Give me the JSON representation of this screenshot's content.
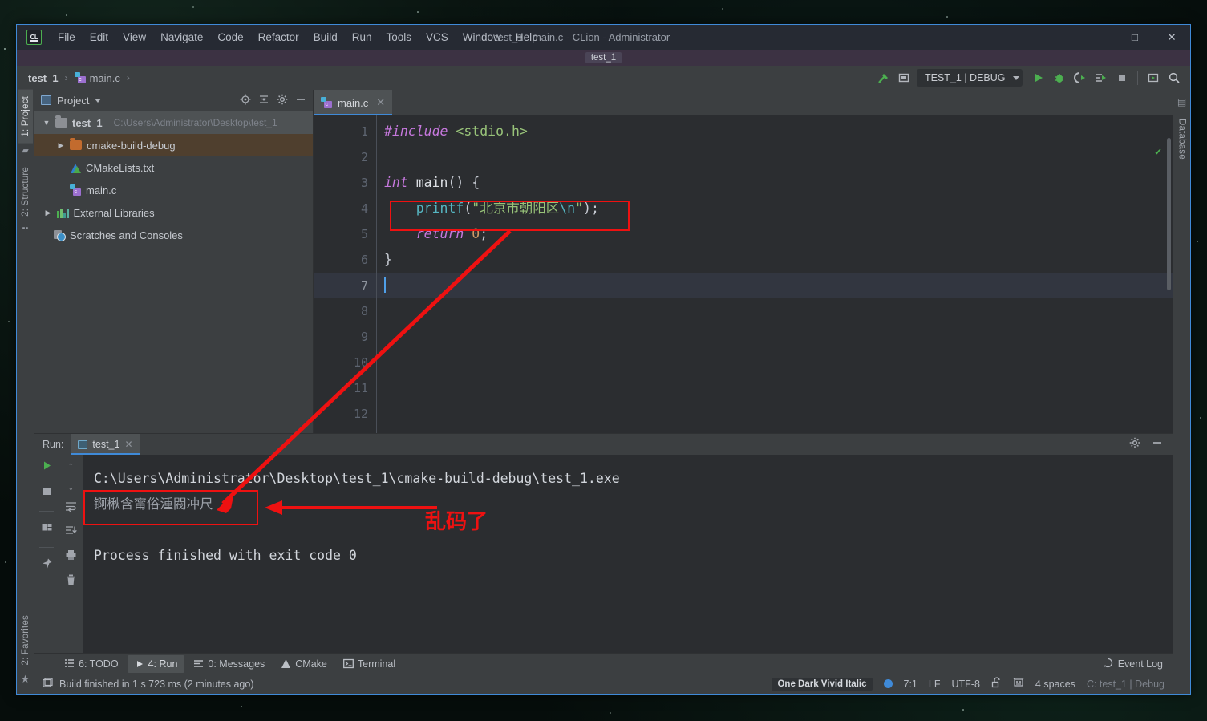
{
  "window": {
    "title": "test_1 - main.c - CLion - Administrator",
    "project_chip": "test_1",
    "logo_text": "CL",
    "minimize": "—",
    "maximize": "□",
    "close": "✕"
  },
  "menu": [
    {
      "label": "File",
      "mnemonic": "F"
    },
    {
      "label": "Edit",
      "mnemonic": "E"
    },
    {
      "label": "View",
      "mnemonic": "V"
    },
    {
      "label": "Navigate",
      "mnemonic": "N"
    },
    {
      "label": "Code",
      "mnemonic": "C"
    },
    {
      "label": "Refactor",
      "mnemonic": "R"
    },
    {
      "label": "Build",
      "mnemonic": "B"
    },
    {
      "label": "Run",
      "mnemonic": "R"
    },
    {
      "label": "Tools",
      "mnemonic": "T"
    },
    {
      "label": "VCS",
      "mnemonic": "V"
    },
    {
      "label": "Window",
      "mnemonic": "W"
    },
    {
      "label": "Help",
      "mnemonic": "H"
    }
  ],
  "navbar": {
    "crumb_project": "test_1",
    "crumb_file": "main.c",
    "separator": "›",
    "run_config": "TEST_1 | DEBUG",
    "icons": [
      "build-hammer-icon",
      "select-target-icon",
      "run-icon",
      "debug-icon",
      "run-with-coverage-icon",
      "profile-icon",
      "stop-icon",
      "update-icon",
      "search-everywhere-icon"
    ]
  },
  "rail_left": {
    "project_tab": "1: Project",
    "structure_tab": "2: Structure",
    "favorites_tab": "2: Favorites"
  },
  "rail_right": {
    "database_tab": "Database"
  },
  "project_panel": {
    "title": "Project",
    "actions": [
      "locate-icon",
      "collapse-all-icon",
      "settings-gear-icon",
      "hide-icon"
    ],
    "tree": [
      {
        "label": "test_1",
        "path": "C:\\Users\\Administrator\\Desktop\\test_1",
        "arrow": "▼",
        "icon": "folder-icon",
        "indent": 0,
        "state": "selected-root"
      },
      {
        "label": "cmake-build-debug",
        "path": "",
        "arrow": "▶",
        "icon": "folder-orange-icon",
        "indent": 1,
        "state": "selected-folder"
      },
      {
        "label": "CMakeLists.txt",
        "path": "",
        "arrow": "",
        "icon": "cmake-file-icon",
        "indent": 1,
        "state": ""
      },
      {
        "label": "main.c",
        "path": "",
        "arrow": "",
        "icon": "c-file-icon",
        "indent": 1,
        "state": ""
      },
      {
        "label": "External Libraries",
        "path": "",
        "arrow": "▶",
        "icon": "library-icon",
        "indent": 0,
        "state": ""
      },
      {
        "label": "Scratches and Consoles",
        "path": "",
        "arrow": "",
        "icon": "scratches-icon",
        "indent": 0,
        "state": ""
      }
    ]
  },
  "editor": {
    "tab_label": "main.c",
    "tab_close": "✕",
    "line_numbers": [
      "1",
      "2",
      "3",
      "4",
      "5",
      "6",
      "7",
      "8",
      "9",
      "10",
      "11",
      "12"
    ],
    "current_line": 7,
    "gutter_run_line": 3,
    "code_lines": [
      {
        "n": 1,
        "tokens": [
          {
            "t": "#include",
            "c": "inc"
          },
          {
            "t": " ",
            "c": "pn"
          },
          {
            "t": "<stdio.h>",
            "c": "hdr"
          }
        ]
      },
      {
        "n": 2,
        "tokens": []
      },
      {
        "n": 3,
        "tokens": [
          {
            "t": "int",
            "c": "kw"
          },
          {
            "t": " ",
            "c": "pn"
          },
          {
            "t": "main",
            "c": "id"
          },
          {
            "t": "() {",
            "c": "pn"
          }
        ]
      },
      {
        "n": 4,
        "tokens": [
          {
            "t": "    ",
            "c": "pn"
          },
          {
            "t": "printf",
            "c": "fn"
          },
          {
            "t": "(",
            "c": "pn"
          },
          {
            "t": "\"北京市朝阳区",
            "c": "str"
          },
          {
            "t": "\\n",
            "c": "esc"
          },
          {
            "t": "\"",
            "c": "str"
          },
          {
            "t": ");",
            "c": "pn"
          }
        ]
      },
      {
        "n": 5,
        "tokens": [
          {
            "t": "    ",
            "c": "pn"
          },
          {
            "t": "return",
            "c": "kw"
          },
          {
            "t": " ",
            "c": "pn"
          },
          {
            "t": "0",
            "c": "num"
          },
          {
            "t": ";",
            "c": "pn"
          }
        ]
      },
      {
        "n": 6,
        "tokens": [
          {
            "t": "}",
            "c": "pn"
          }
        ]
      },
      {
        "n": 7,
        "tokens": []
      },
      {
        "n": 8,
        "tokens": []
      },
      {
        "n": 9,
        "tokens": []
      },
      {
        "n": 10,
        "tokens": []
      },
      {
        "n": 11,
        "tokens": []
      },
      {
        "n": 12,
        "tokens": []
      }
    ]
  },
  "run_panel": {
    "run_label": "Run:",
    "tab_label": "test_1",
    "tab_close": "✕",
    "actions": [
      "settings-gear-icon",
      "hide-icon"
    ],
    "tools_left": [
      "rerun-icon",
      "stop-icon",
      "layout-icon",
      "pin-icon"
    ],
    "tools_right": [
      "up-arrow-icon",
      "down-arrow-icon",
      "soft-wrap-icon",
      "scroll-to-end-icon",
      "print-icon",
      "clear-all-icon"
    ],
    "console_lines": [
      {
        "text": "C:\\Users\\Administrator\\Desktop\\test_1\\cmake-build-debug\\test_1.exe",
        "style": "normal"
      },
      {
        "text": "锕楸含甯俗湩閥冲尺",
        "style": "garble"
      },
      {
        "text": "",
        "style": "normal"
      },
      {
        "text": "Process finished with exit code 0",
        "style": "normal"
      }
    ]
  },
  "bottom_bar": {
    "items": [
      {
        "label": "6: TODO",
        "mnemonic": "6",
        "icon": "todo-icon",
        "selected": false
      },
      {
        "label": "4: Run",
        "mnemonic": "4",
        "icon": "run-icon",
        "selected": true
      },
      {
        "label": "0: Messages",
        "mnemonic": "0",
        "icon": "messages-icon",
        "selected": false
      },
      {
        "label": "CMake",
        "mnemonic": "",
        "icon": "cmake-icon",
        "selected": false
      },
      {
        "label": "Terminal",
        "mnemonic": "",
        "icon": "terminal-icon",
        "selected": false
      }
    ],
    "event_log": "Event Log"
  },
  "status_bar": {
    "build_message": "Build finished in 1 s 723 ms (2 minutes ago)",
    "color_scheme": "One Dark Vivid Italic",
    "caret_position": "7:1",
    "line_separator": "LF",
    "encoding": "UTF-8",
    "lock_icon": "unlocked-icon",
    "git_icon": "git-branch-icon",
    "indent": "4 spaces",
    "toolchain": "C: test_1 | Debug"
  },
  "annotations": {
    "garble_note": "乱码了",
    "accent_color": "#ee1111",
    "boxes": [
      "printf-line-highlight",
      "garbled-output-highlight"
    ]
  }
}
